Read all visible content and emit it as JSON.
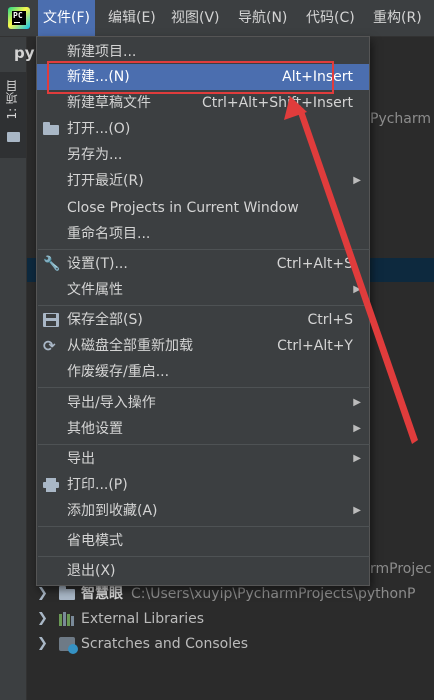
{
  "menubar": {
    "app_icon_text": "PC",
    "items": [
      {
        "label": "文件(F)"
      },
      {
        "label": "编辑(E)"
      },
      {
        "label": "视图(V)"
      },
      {
        "label": "导航(N)"
      },
      {
        "label": "代码(C)"
      },
      {
        "label": "重构(R)"
      }
    ]
  },
  "background": {
    "side_tab_label": "1: 项目",
    "project_title": "py",
    "right_text_1": "Pycharm",
    "right_text_2": "rmProjec",
    "tree": [
      {
        "label": "智慧眼",
        "path": "C:\\Users\\xuyip\\PycharmProjects\\pythonP",
        "icon": "folder-icon"
      },
      {
        "label": "External Libraries",
        "path": "",
        "icon": "library-icon"
      },
      {
        "label": "Scratches and Consoles",
        "path": "",
        "icon": "scratches-icon"
      }
    ]
  },
  "file_menu": {
    "items": [
      {
        "label": "新建项目...",
        "shortcut": "",
        "submenu": false,
        "icon": ""
      },
      {
        "label": "新建...(N)",
        "shortcut": "Alt+Insert",
        "submenu": false,
        "icon": "",
        "highlighted": true
      },
      {
        "label": "新建草稿文件",
        "shortcut": "Ctrl+Alt+Shift+Insert",
        "submenu": false,
        "icon": ""
      },
      {
        "label": "打开...(O)",
        "shortcut": "",
        "submenu": false,
        "icon": "open-folder-icon"
      },
      {
        "label": "另存为...",
        "shortcut": "",
        "submenu": false,
        "icon": ""
      },
      {
        "label": "打开最近(R)",
        "shortcut": "",
        "submenu": true,
        "icon": ""
      },
      {
        "label": "Close Projects in Current Window",
        "shortcut": "",
        "submenu": false,
        "icon": ""
      },
      {
        "label": "重命名项目...",
        "shortcut": "",
        "submenu": false,
        "icon": ""
      },
      {
        "label": "设置(T)...",
        "shortcut": "Ctrl+Alt+S",
        "submenu": false,
        "icon": "wrench-icon"
      },
      {
        "label": "文件属性",
        "shortcut": "",
        "submenu": true,
        "icon": ""
      },
      {
        "label": "保存全部(S)",
        "shortcut": "Ctrl+S",
        "submenu": false,
        "icon": "save-icon"
      },
      {
        "label": "从磁盘全部重新加载",
        "shortcut": "Ctrl+Alt+Y",
        "submenu": false,
        "icon": "sync-icon"
      },
      {
        "label": "作废缓存/重启...",
        "shortcut": "",
        "submenu": false,
        "icon": ""
      },
      {
        "label": "导出/导入操作",
        "shortcut": "",
        "submenu": true,
        "icon": ""
      },
      {
        "label": "其他设置",
        "shortcut": "",
        "submenu": true,
        "icon": ""
      },
      {
        "label": "导出",
        "shortcut": "",
        "submenu": true,
        "icon": ""
      },
      {
        "label": "打印...(P)",
        "shortcut": "",
        "submenu": false,
        "icon": "print-icon"
      },
      {
        "label": "添加到收藏(A)",
        "shortcut": "",
        "submenu": true,
        "icon": ""
      },
      {
        "label": "省电模式",
        "shortcut": "",
        "submenu": false,
        "icon": ""
      },
      {
        "label": "退出(X)",
        "shortcut": "",
        "submenu": false,
        "icon": ""
      }
    ]
  },
  "colors": {
    "highlight": "#4b6eaf",
    "annotation": "#e03c3c"
  }
}
